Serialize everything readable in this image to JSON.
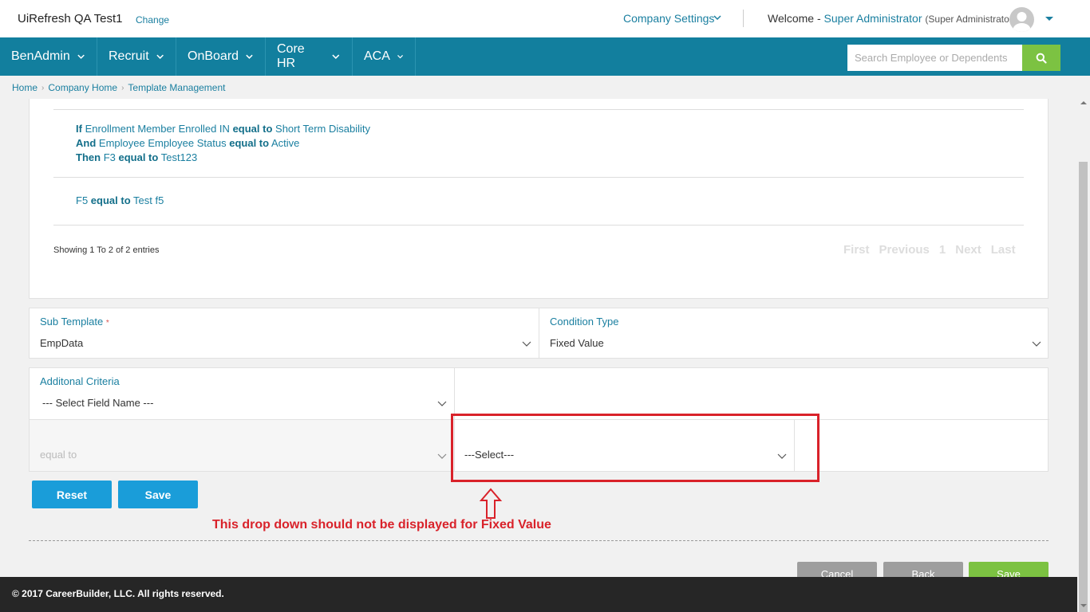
{
  "header": {
    "company_name": "UiRefresh QA Test1",
    "change_label": "Change",
    "company_settings_label": "Company Settings",
    "welcome_label": "Welcome -",
    "user_name": "Super Administrator",
    "user_role": "(Super Administrator)"
  },
  "nav": {
    "items": [
      {
        "label": "BenAdmin"
      },
      {
        "label": "Recruit"
      },
      {
        "label": "OnBoard"
      },
      {
        "label": "Core HR"
      },
      {
        "label": "ACA"
      }
    ],
    "search_placeholder": "Search Employee or Dependents"
  },
  "breadcrumb": [
    "Home",
    "Company Home",
    "Template Management"
  ],
  "rules": {
    "rule1": {
      "if_kw": "If",
      "if_field": "Enrollment Member Enrolled IN",
      "op": "equal to",
      "if_value": "Short Term Disability",
      "and_kw": "And",
      "and_field": "Employee Employee Status",
      "and_value": "Active",
      "then_kw": "Then",
      "then_field": "F3",
      "then_value": "Test123"
    },
    "rule2": {
      "field": "F5",
      "op": "equal to",
      "value": "Test f5"
    },
    "showing": "Showing 1 To 2 of 2 entries",
    "pager": {
      "first": "First",
      "previous": "Previous",
      "page": "1",
      "next": "Next",
      "last": "Last"
    }
  },
  "form": {
    "sub_template_label": "Sub Template",
    "sub_template_value": "EmpData",
    "required_mark": "*",
    "condition_type_label": "Condition Type",
    "condition_type_value": "Fixed Value",
    "additional_criteria_label": "Additonal Criteria",
    "field_name_value": "--- Select Field Name ---",
    "operator_value": "equal to",
    "value_select": "---Select---"
  },
  "buttons": {
    "reset": "Reset",
    "save": "Save",
    "cancel": "Cancel",
    "back": "Back",
    "save_bottom": "Save"
  },
  "annotation": {
    "text": "This drop down should not be displayed for Fixed Value"
  },
  "footer": {
    "copyright": "© 2017 CareerBuilder, LLC. All rights reserved."
  },
  "colors": {
    "nav_bg": "#127f9e",
    "link": "#1a7fa0",
    "search_button": "#7cc242",
    "primary_button": "#1a9dd9",
    "annotation": "#d9222a",
    "footer_bg": "#262626"
  }
}
